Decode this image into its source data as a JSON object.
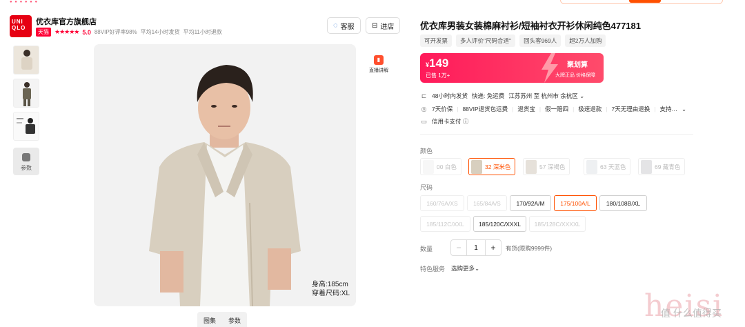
{
  "store": {
    "logo_text": "UNI QLO",
    "name": "优衣库官方旗舰店",
    "badge": "天猫",
    "stars": "★★★★★",
    "score": "5.0",
    "stats": [
      "88VIP好评率98%",
      "平均14小时发货",
      "平均11小时退款"
    ],
    "service_btn": "客服",
    "enter_btn": "进店"
  },
  "gallery": {
    "param_label": "参数",
    "live_label": "直播讲解",
    "model_info": [
      "身高:185cm",
      "穿着尺码:XL"
    ],
    "tabs": [
      "图集",
      "参数"
    ]
  },
  "product": {
    "title": "优衣库男装女装棉麻衬衫/短袖衬衣开衫休闲纯色477181",
    "tags": [
      "可开发票",
      "多人评价\"尺码合适\"",
      "回头客969人",
      "超2万人加购"
    ],
    "price_currency": "¥",
    "price": "149",
    "sold": "已售 1万+",
    "promo_title": "聚划算",
    "promo_sub": "大牌正品  价格保障"
  },
  "shipping": [
    {
      "icon": "truck-icon",
      "texts": [
        "48小时内发货",
        "快递: 免运费",
        "江苏苏州 至 杭州市 余杭区 ⌄"
      ]
    },
    {
      "icon": "shield-icon",
      "texts": [
        "7天价保",
        "88VIP退货包运费",
        "退货宝",
        "假一赔四",
        "极速退款",
        "7天无理由退换",
        "支持…",
        "⌄"
      ]
    },
    {
      "icon": "credit-card-icon",
      "texts": [
        "信用卡支付 ⓘ"
      ]
    }
  ],
  "labels": {
    "color": "颜色",
    "size": "尺码",
    "quantity": "数量",
    "special": "特色服务"
  },
  "colors": [
    {
      "label": "00 白色",
      "selected": false
    },
    {
      "label": "32 深米色",
      "selected": true
    },
    {
      "label": "57 深褐色",
      "selected": false
    },
    {
      "label": "63 天蓝色",
      "selected": false
    },
    {
      "label": "69 藏青色",
      "selected": false
    }
  ],
  "sizes": [
    {
      "label": "160/76A/XS",
      "state": "disabled"
    },
    {
      "label": "165/84A/S",
      "state": "disabled"
    },
    {
      "label": "170/92A/M",
      "state": "available"
    },
    {
      "label": "175/100A/L",
      "state": "selected"
    },
    {
      "label": "180/108B/XL",
      "state": "available"
    },
    {
      "label": "185/112C/XXL",
      "state": "disabled"
    },
    {
      "label": "185/120C/XXXL",
      "state": "available"
    },
    {
      "label": "185/128C/XXXXL",
      "state": "disabled"
    }
  ],
  "quantity": {
    "minus": "−",
    "value": "1",
    "plus": "+",
    "stock": "有货(限购9999件)"
  },
  "special_value": "选购更多⌄",
  "watermark": {
    "main": "heisi",
    "sub": "值 什么值得买"
  },
  "colors_theme": {
    "accent": "#ff5000",
    "price_bg": "#ff1a5a",
    "brand_red": "#e60012"
  }
}
